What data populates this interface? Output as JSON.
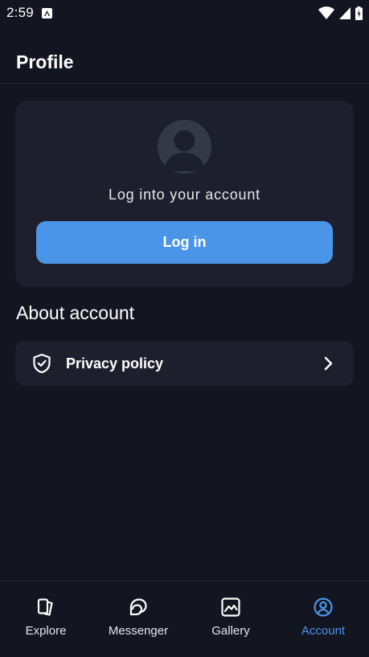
{
  "status_bar": {
    "time": "2:59"
  },
  "header": {
    "title": "Profile"
  },
  "login_card": {
    "prompt": "Log into your account",
    "button_label": "Log in"
  },
  "about": {
    "title": "About account",
    "items": [
      {
        "label": "Privacy policy",
        "icon": "shield-check-icon"
      }
    ]
  },
  "bottom_nav": {
    "items": [
      {
        "label": "Explore",
        "icon": "explore-icon",
        "active": false
      },
      {
        "label": "Messenger",
        "icon": "messenger-icon",
        "active": false
      },
      {
        "label": "Gallery",
        "icon": "gallery-icon",
        "active": false
      },
      {
        "label": "Account",
        "icon": "account-icon",
        "active": true
      }
    ]
  },
  "colors": {
    "background": "#131520",
    "card": "#1d202c",
    "accent": "#4a95e8",
    "text": "#ffffff"
  }
}
